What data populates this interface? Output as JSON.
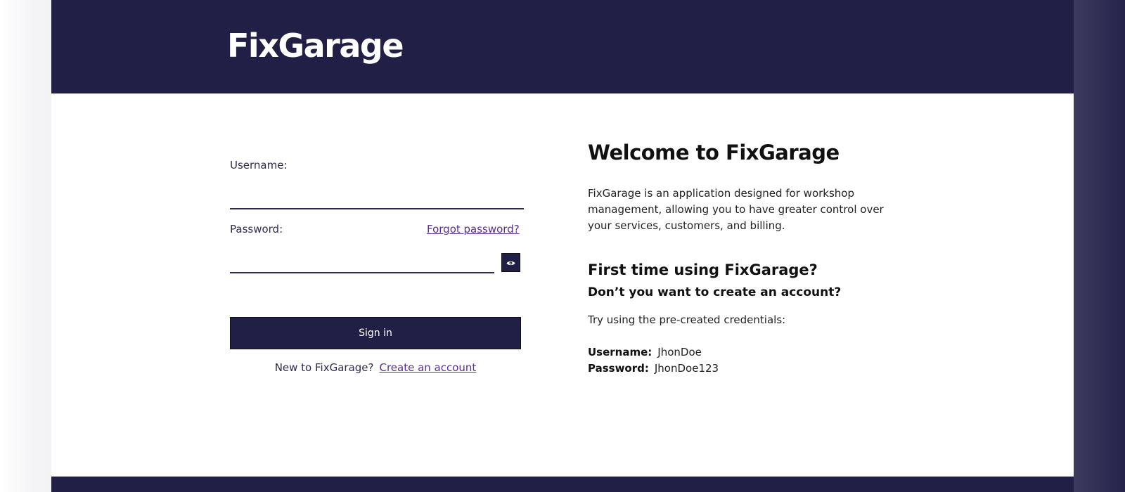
{
  "header": {
    "logo_text": "FixGarage"
  },
  "login_form": {
    "username_label": "Username:",
    "username_value": "",
    "password_label": "Password:",
    "password_value": "",
    "forgot_password_link": "Forgot password?",
    "show_password_icon": "eye-icon",
    "signin_button": "Sign in",
    "new_user_text": "New to FixGarage?",
    "create_account_link": "Create an account"
  },
  "welcome": {
    "title": "Welcome to FixGarage",
    "description": "FixGarage is an application designed for workshop management, allowing you to have greater control over your services, customers, and billing.",
    "first_time_heading": "First time using FixGarage?",
    "create_account_prompt": "Don’t you want to create an account?",
    "try_credentials_text": "Try using the pre-created credentials:",
    "credentials": {
      "username_key": "Username:",
      "username_value": "JhonDoe",
      "password_key": "Password:",
      "password_value": "JhonDoe123"
    }
  },
  "colors": {
    "brand_dark": "#221f46",
    "link": "#5a2e8f",
    "background": "#ffffff"
  }
}
